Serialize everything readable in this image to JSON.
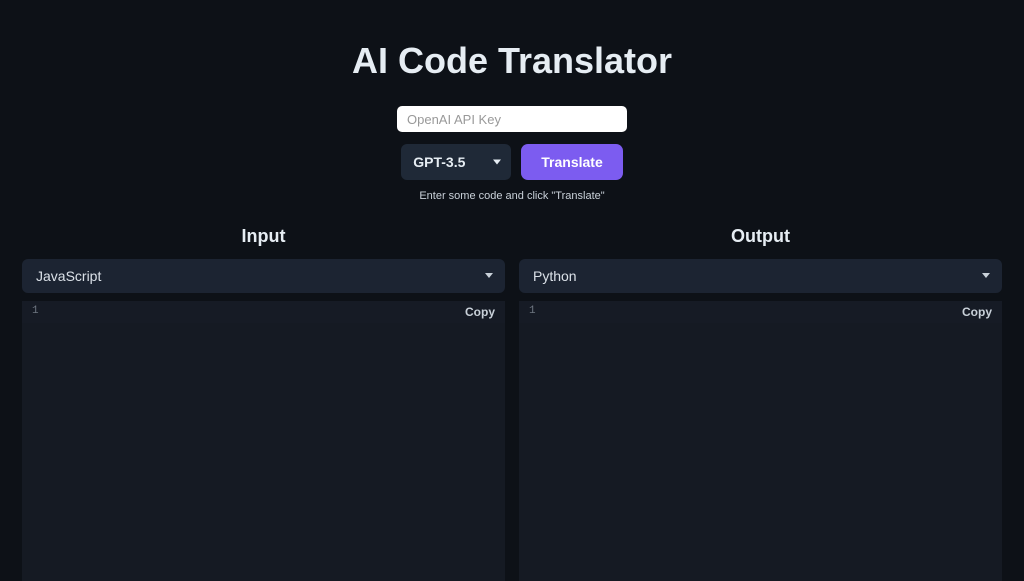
{
  "header": {
    "title": "AI Code Translator"
  },
  "apiKey": {
    "placeholder": "OpenAI API Key",
    "value": ""
  },
  "modelSelect": {
    "selected": "GPT-3.5"
  },
  "translateButton": {
    "label": "Translate"
  },
  "hint": "Enter some code and click \"Translate\"",
  "inputPanel": {
    "title": "Input",
    "language": "JavaScript",
    "lineNumber": "1",
    "copyLabel": "Copy"
  },
  "outputPanel": {
    "title": "Output",
    "language": "Python",
    "lineNumber": "1",
    "copyLabel": "Copy"
  }
}
